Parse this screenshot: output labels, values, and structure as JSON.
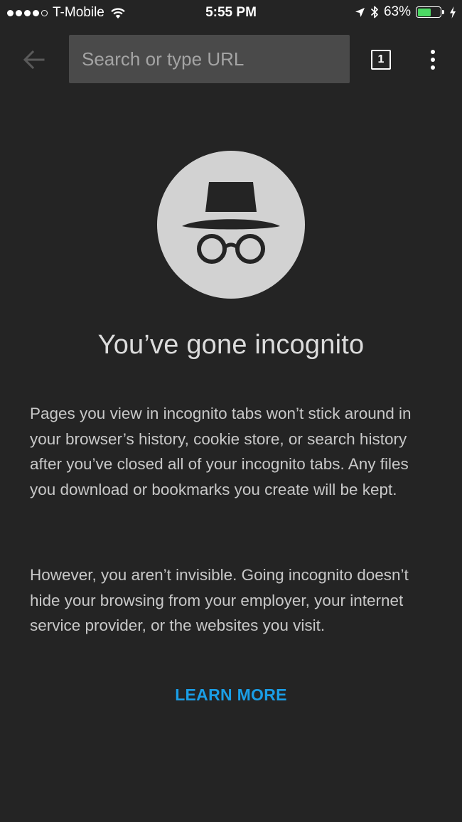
{
  "status_bar": {
    "carrier": "T-Mobile",
    "time": "5:55 PM",
    "battery_percent": "63%",
    "battery_level": 0.63,
    "signal_bars_filled": 4,
    "signal_bars_total": 5
  },
  "toolbar": {
    "search_placeholder": "Search or type URL",
    "tab_count": "1"
  },
  "ntp": {
    "title": "You’ve gone incognito",
    "paragraph_1": "Pages you view in incognito tabs won’t stick around in your browser’s history, cookie store, or search history after you’ve closed all of your incognito tabs. Any files you download or bookmarks you create will be kept.",
    "paragraph_2": "However, you aren’t invisible. Going incognito doesn’t hide your browsing from your employer, your internet service provider, or the websites you visit.",
    "learn_more": "LEARN MORE"
  },
  "colors": {
    "background": "#242424",
    "omnibox": "#4a4a4a",
    "link": "#1a9ee6",
    "battery": "#4cd964"
  }
}
